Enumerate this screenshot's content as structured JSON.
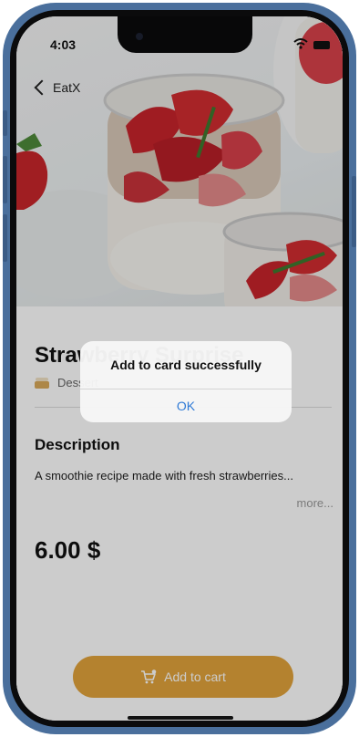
{
  "status_bar": {
    "time": "4:03"
  },
  "nav": {
    "back_label": "EatX"
  },
  "product": {
    "name": "Strawberry Surprise",
    "category": "Dessert",
    "description_heading": "Description",
    "description": "A smoothie recipe made with fresh strawberries...",
    "more_label": "more...",
    "price": "6.00 $"
  },
  "actions": {
    "add_to_cart_label": "Add to cart"
  },
  "alert": {
    "message": "Add to card successfully",
    "ok_label": "OK"
  },
  "colors": {
    "accent": "#e2a33b",
    "alert_button": "#2f7ad6",
    "frame": "#4a6f9c"
  }
}
